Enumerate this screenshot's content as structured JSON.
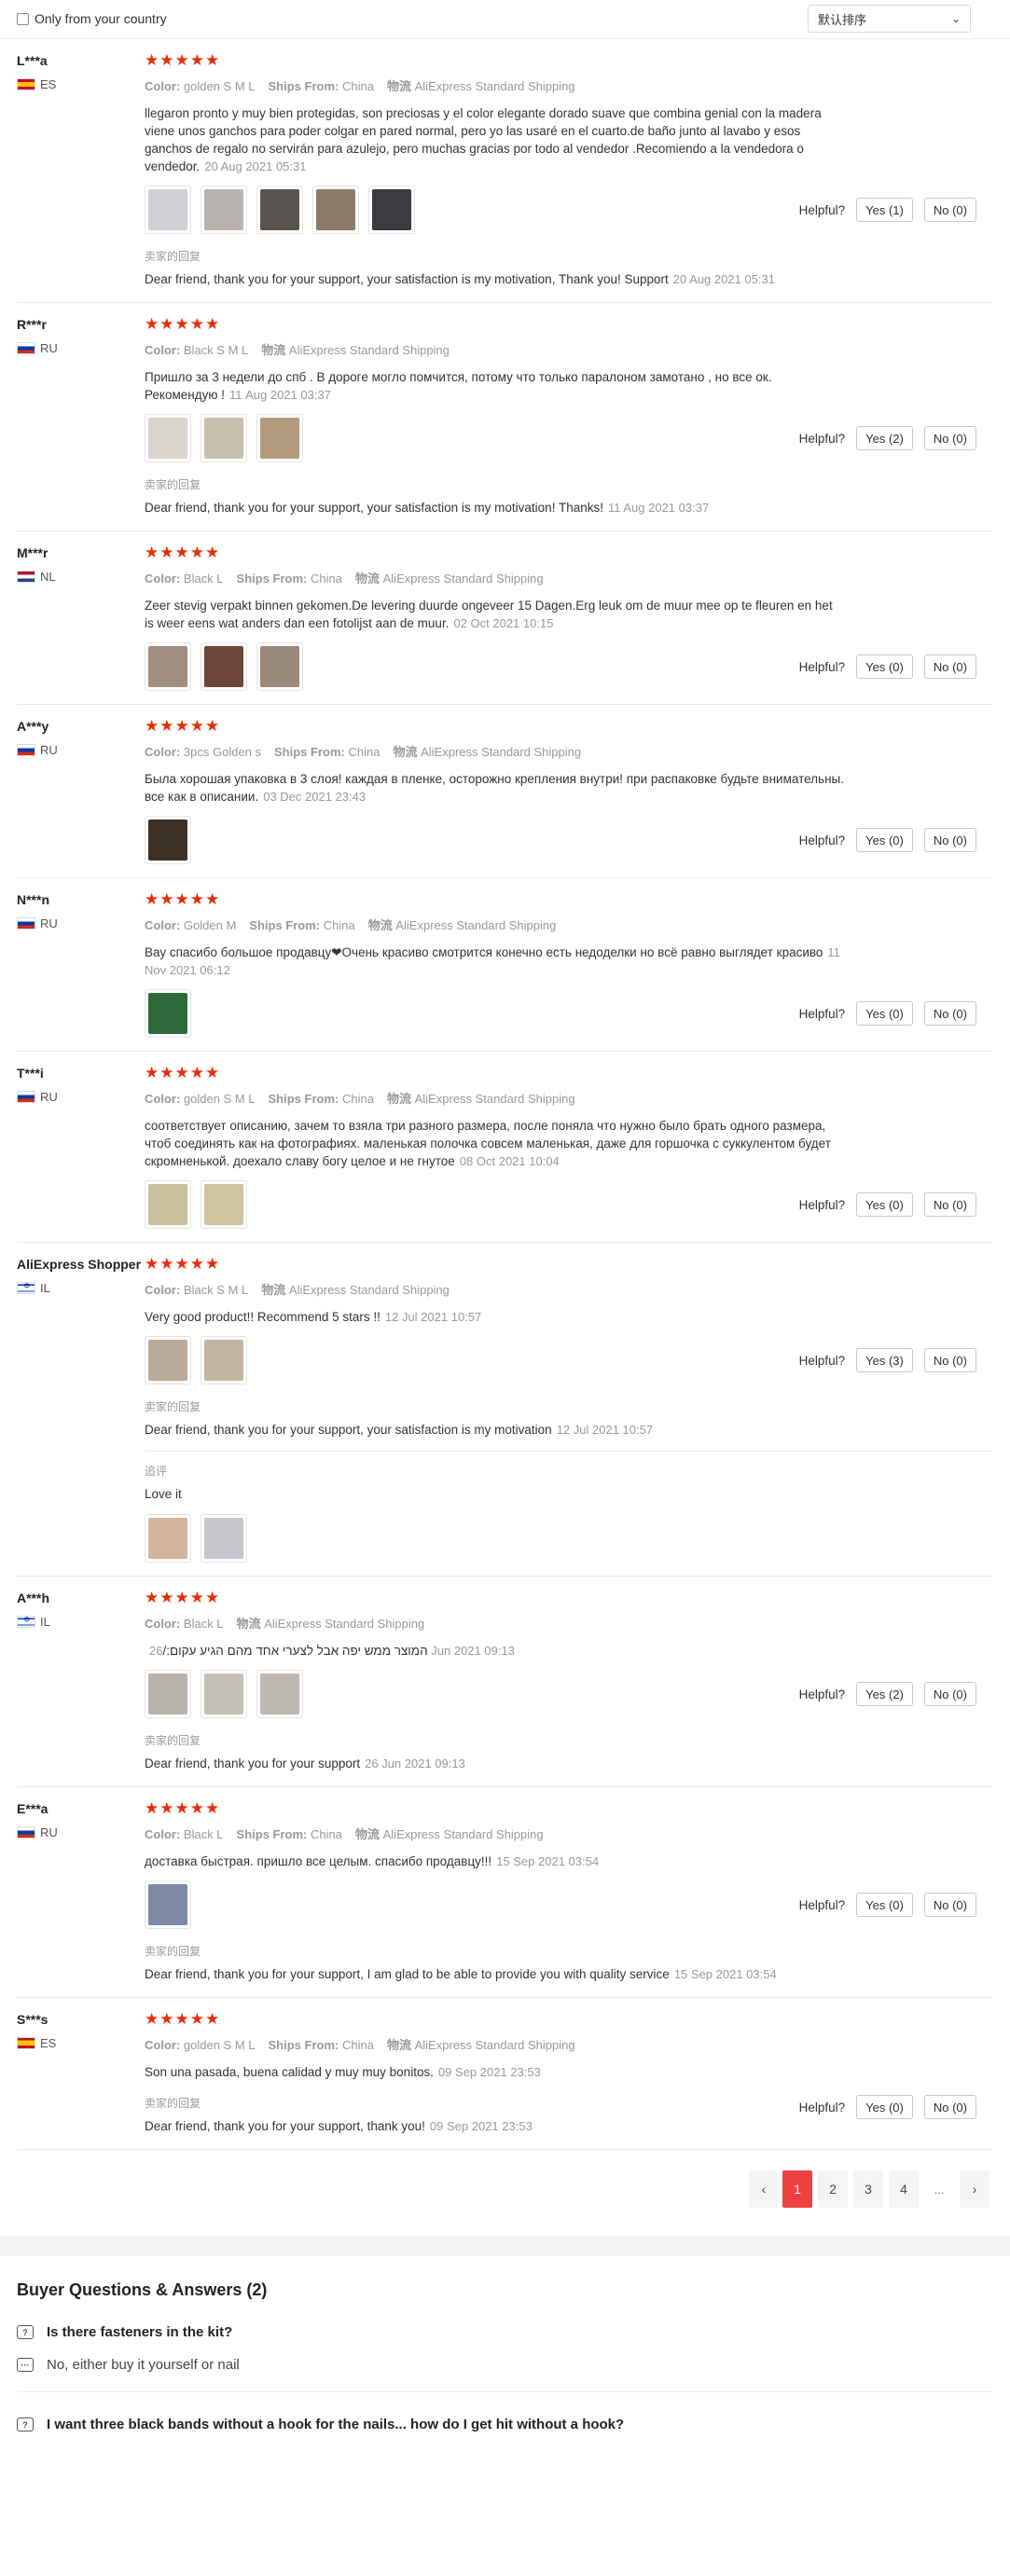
{
  "filter": {
    "country_label": "Only from your country",
    "sort_label": "默认排序"
  },
  "labels": {
    "color": "Color:",
    "ships_from": "Ships From:",
    "shipping_key": "物流",
    "helpful": "Helpful?",
    "seller_reply": "卖家的回复",
    "additional": "追评"
  },
  "reviews": [
    {
      "user": "L***a",
      "country": "ES",
      "stars": 5,
      "color": "golden S M L",
      "ships_from": "China",
      "shipping": "AliExpress Standard Shipping",
      "text": "llegaron pronto y muy bien protegidas, son preciosas y el color elegante dorado suave que combina genial con la madera viene unos ganchos para poder colgar en pared normal, pero yo las usaré en el cuarto.de baño junto al lavabo y esos ganchos de regalo no servirán para azulejo, pero muchas gracias por todo al vendedor .Recomiendo a la vendedora o vendedor.",
      "date": "20 Aug 2021 05:31",
      "images": [
        "#cfcfd4",
        "#b7b4b0",
        "#5a5450",
        "#8a7a66",
        "#3c3c40"
      ],
      "yes": "Yes (1)",
      "no": "No (0)",
      "reply": "Dear friend, thank you for your support, your satisfaction is my motivation, Thank you! Support",
      "reply_date": "20 Aug 2021 05:31"
    },
    {
      "user": "R***r",
      "country": "RU",
      "stars": 5,
      "color": "Black S M L",
      "ships_from": "",
      "shipping": "AliExpress Standard Shipping",
      "text": "Пришло за 3 недели до спб . В дороге могло помчится, потому что только паралоном замотано , но все ок. Рекомендую !",
      "date": "11 Aug 2021 03:37",
      "images": [
        "#d8d4cc",
        "#c8bfae",
        "#b39c7e"
      ],
      "yes": "Yes (2)",
      "no": "No (0)",
      "reply": "Dear friend, thank you for your support, your satisfaction is my motivation! Thanks!",
      "reply_date": "11 Aug 2021 03:37"
    },
    {
      "user": "M***r",
      "country": "NL",
      "stars": 5,
      "color": "Black L",
      "ships_from": "China",
      "shipping": "AliExpress Standard Shipping",
      "text": "Zeer stevig verpakt binnen gekomen.De levering duurde ongeveer 15 Dagen.Erg leuk om de muur mee op te fleuren en het is weer eens wat anders dan een fotolijst aan de muur.",
      "date": "02 Oct 2021 10:15",
      "images": [
        "#a08f80",
        "#6e4638",
        "#9a8a7c"
      ],
      "yes": "Yes (0)",
      "no": "No (0)"
    },
    {
      "user": "A***y",
      "country": "RU",
      "stars": 5,
      "color": "3pcs Golden s",
      "ships_from": "China",
      "shipping": "AliExpress Standard Shipping",
      "text": "Была хорошая упаковка в 3 слоя! каждая в пленке, осторожно крепления внутри! при распаковке будьте внимательны. все как в описании.",
      "date": "03 Dec 2021 23:43",
      "images": [
        "#3a3026"
      ],
      "yes": "Yes (0)",
      "no": "No (0)"
    },
    {
      "user": "N***n",
      "country": "RU",
      "stars": 5,
      "color": "Golden M",
      "ships_from": "China",
      "shipping": "AliExpress Standard Shipping",
      "text": "Вау спасибо большое продавцу❤Очень красиво смотрится конечно есть недоделки но всё равно выглядет красиво",
      "date": "11 Nov 2021 06:12",
      "images": [
        "#2e6a3a"
      ],
      "yes": "Yes (0)",
      "no": "No (0)"
    },
    {
      "user": "T***i",
      "country": "RU",
      "stars": 5,
      "color": "golden S M L",
      "ships_from": "China",
      "shipping": "AliExpress Standard Shipping",
      "text": "соответствует описанию, зачем то взяла три разного размера, после поняла что нужно было брать одного размера, чтоб соединять как на фотографиях. маленькая полочка совсем маленькая, даже для горшочка с суккулентом будет скромненькой. доехало славу богу целое и не гнутое",
      "date": "08 Oct 2021 10:04",
      "images": [
        "#c9bf9a",
        "#cfc3a0"
      ],
      "yes": "Yes (0)",
      "no": "No (0)"
    },
    {
      "user": "AliExpress Shopper",
      "country": "IL",
      "stars": 5,
      "color": "Black S M L",
      "ships_from": "",
      "shipping": "AliExpress Standard Shipping",
      "text": "Very good product!! Recommend 5 stars !!",
      "date": "12 Jul 2021 10:57",
      "images": [
        "#b9aa9a",
        "#c2b4a0"
      ],
      "yes": "Yes (3)",
      "no": "No (0)",
      "reply": "Dear friend, thank you for your support, your satisfaction is my motivation",
      "reply_date": "12 Jul 2021 10:57",
      "additional_text": "Love it",
      "additional_images": [
        "#d4b49a",
        "#c8c4cc"
      ]
    },
    {
      "user": "A***h",
      "country": "IL",
      "stars": 5,
      "color": "Black L",
      "ships_from": "",
      "shipping": "AliExpress Standard Shipping",
      "text": "המוצר ממש יפה אבל לצערי אחד מהם הגיע עקום:/",
      "date": "26 Jun 2021 09:13",
      "images": [
        "#b8b4ac",
        "#c4c0b6",
        "#bdb8b0"
      ],
      "yes": "Yes (2)",
      "no": "No (0)",
      "reply": "Dear friend, thank you for your support",
      "reply_date": "26 Jun 2021 09:13"
    },
    {
      "user": "E***a",
      "country": "RU",
      "stars": 5,
      "color": "Black L",
      "ships_from": "China",
      "shipping": "AliExpress Standard Shipping",
      "text": "доставка быстрая. пришло все целым. спасибо продавцу!!!",
      "date": "15 Sep 2021 03:54",
      "images": [
        "#7e8aa6"
      ],
      "yes": "Yes (0)",
      "no": "No (0)",
      "reply": "Dear friend, thank you for your support, I am glad to be able to provide you with quality service",
      "reply_date": "15 Sep 2021 03:54"
    },
    {
      "user": "S***s",
      "country": "ES",
      "stars": 5,
      "color": "golden S M L",
      "ships_from": "China",
      "shipping": "AliExpress Standard Shipping",
      "text": "Son una pasada, buena calidad y muy muy bonitos.",
      "date": "09 Sep 2021 23:53",
      "images": [],
      "yes": "Yes (0)",
      "no": "No (0)",
      "reply": "Dear friend, thank you for your support, thank you!",
      "reply_date": "09 Sep 2021 23:53"
    }
  ],
  "pagination": {
    "prev": "‹",
    "pages": [
      "1",
      "2",
      "3",
      "4"
    ],
    "ellipsis": "...",
    "next": "›",
    "current": "1"
  },
  "qa": {
    "title": "Buyer Questions & Answers (2)",
    "items": [
      {
        "q": "Is there fasteners in the kit?",
        "a": "No, either buy it yourself or nail"
      },
      {
        "q": "I want three black bands without a hook for the nails... how do I get hit without a hook?"
      }
    ]
  },
  "colors": {
    "star": "#e62e04",
    "page_active": "#ef4040"
  }
}
